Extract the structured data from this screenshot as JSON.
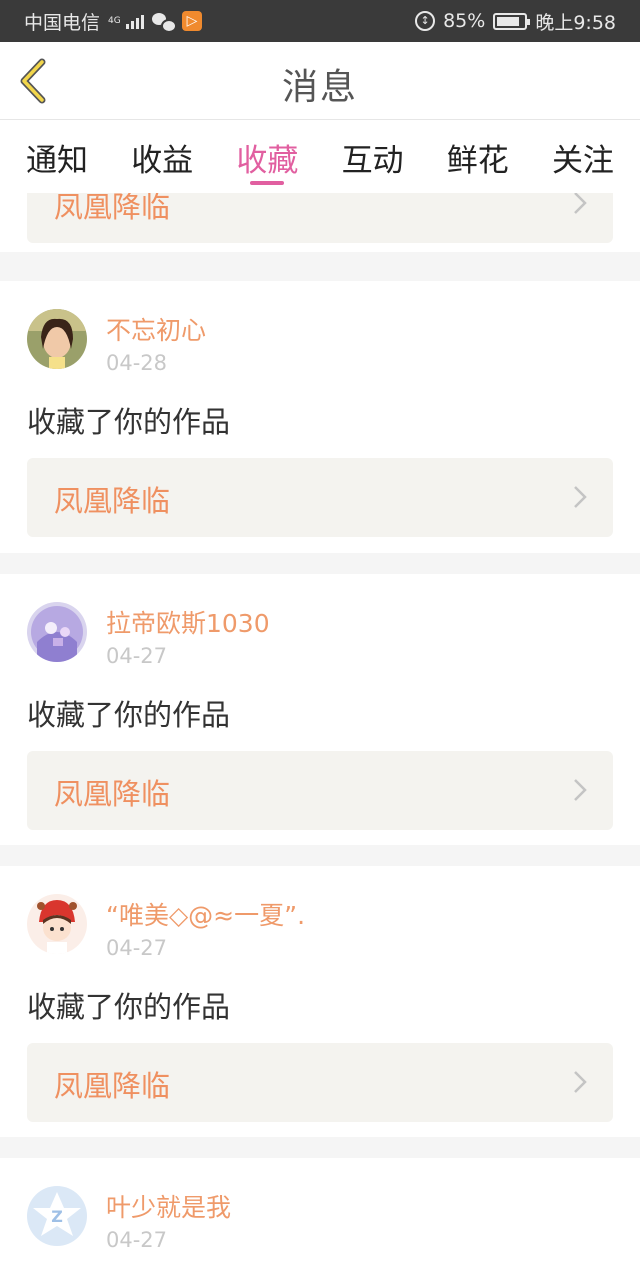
{
  "status_bar": {
    "carrier": "中国电信",
    "network": "4G",
    "battery": "85%",
    "time": "晚上9:58",
    "app_badge": "▷"
  },
  "header": {
    "title": "消息"
  },
  "tabs": [
    {
      "label": "通知"
    },
    {
      "label": "收益"
    },
    {
      "label": "收藏"
    },
    {
      "label": "互动"
    },
    {
      "label": "鲜花"
    },
    {
      "label": "关注"
    }
  ],
  "top_partial": {
    "work": "凤凰降临"
  },
  "items": [
    {
      "username": "不忘初心",
      "date": "04-28",
      "action": "收藏了你的作品",
      "work": "凤凰降临"
    },
    {
      "username": "拉帝欧斯1030",
      "date": "04-27",
      "action": "收藏了你的作品",
      "work": "凤凰降临"
    },
    {
      "username": "“唯美◇@≈一夏”.",
      "date": "04-27",
      "action": "收藏了你的作品",
      "work": "凤凰降临"
    },
    {
      "username": "叶少就是我",
      "date": "04-27"
    }
  ],
  "colors": {
    "accent_tab": "#e15fa0",
    "username": "#ef9a6a",
    "work_title": "#ef9060"
  }
}
